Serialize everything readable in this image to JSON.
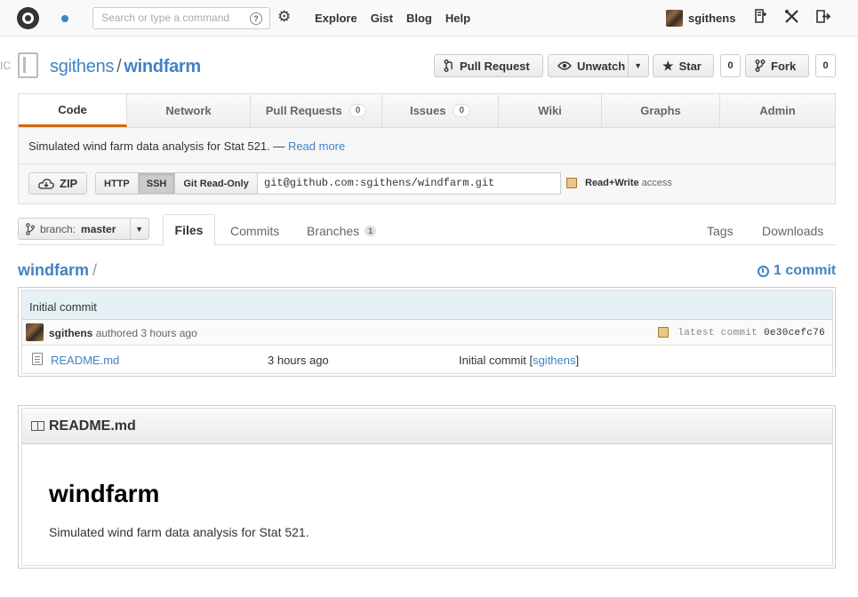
{
  "header": {
    "search_placeholder": "Search or type a command",
    "help_glyph": "?",
    "nav": [
      "Explore",
      "Gist",
      "Blog",
      "Help"
    ],
    "username": "sgithens"
  },
  "repo": {
    "cut_label": "IC",
    "owner": "sgithens",
    "separator": "/",
    "name": "windfarm",
    "buttons": {
      "pull_request": "Pull Request",
      "unwatch": "Unwatch",
      "star": "Star",
      "star_count": "0",
      "fork": "Fork",
      "fork_count": "0"
    }
  },
  "tabs": [
    {
      "label": "Code",
      "count": ""
    },
    {
      "label": "Network",
      "count": ""
    },
    {
      "label": "Pull Requests",
      "count": "0"
    },
    {
      "label": "Issues",
      "count": "0"
    },
    {
      "label": "Wiki",
      "count": ""
    },
    {
      "label": "Graphs",
      "count": ""
    },
    {
      "label": "Admin",
      "count": ""
    }
  ],
  "description": {
    "text": "Simulated wind farm data analysis for Stat 521. —",
    "read_more": "Read more"
  },
  "clone": {
    "zip": "ZIP",
    "protocols": [
      "HTTP",
      "SSH",
      "Git Read-Only"
    ],
    "url": "git@github.com:sgithens/windfarm.git",
    "access_bold": "Read+Write",
    "access_rest": "access"
  },
  "subnav": {
    "branch_label": "branch:",
    "branch_name": "master",
    "files": "Files",
    "commits": "Commits",
    "branches": "Branches",
    "branches_count": "1",
    "tags": "Tags",
    "downloads": "Downloads"
  },
  "breadcrumb": {
    "root": "windfarm",
    "slash": "/",
    "commit_count": "1 commit"
  },
  "filebox": {
    "commit_message": "Initial commit",
    "author": "sgithens",
    "authored": "authored 3 hours ago",
    "latest_label": "latest commit",
    "sha": "0e30cefc76",
    "files": [
      {
        "name": "README.md",
        "age": "3 hours ago",
        "message": "Initial commit [",
        "author_link": "sgithens",
        "message_end": "]"
      }
    ]
  },
  "readme": {
    "filename": "README.md",
    "heading": "windfarm",
    "body": "Simulated wind farm data analysis for Stat 521."
  },
  "colors": {
    "link": "#4183c4",
    "active_tab": "#d26911",
    "commit_bar": "#e6f1f6"
  }
}
